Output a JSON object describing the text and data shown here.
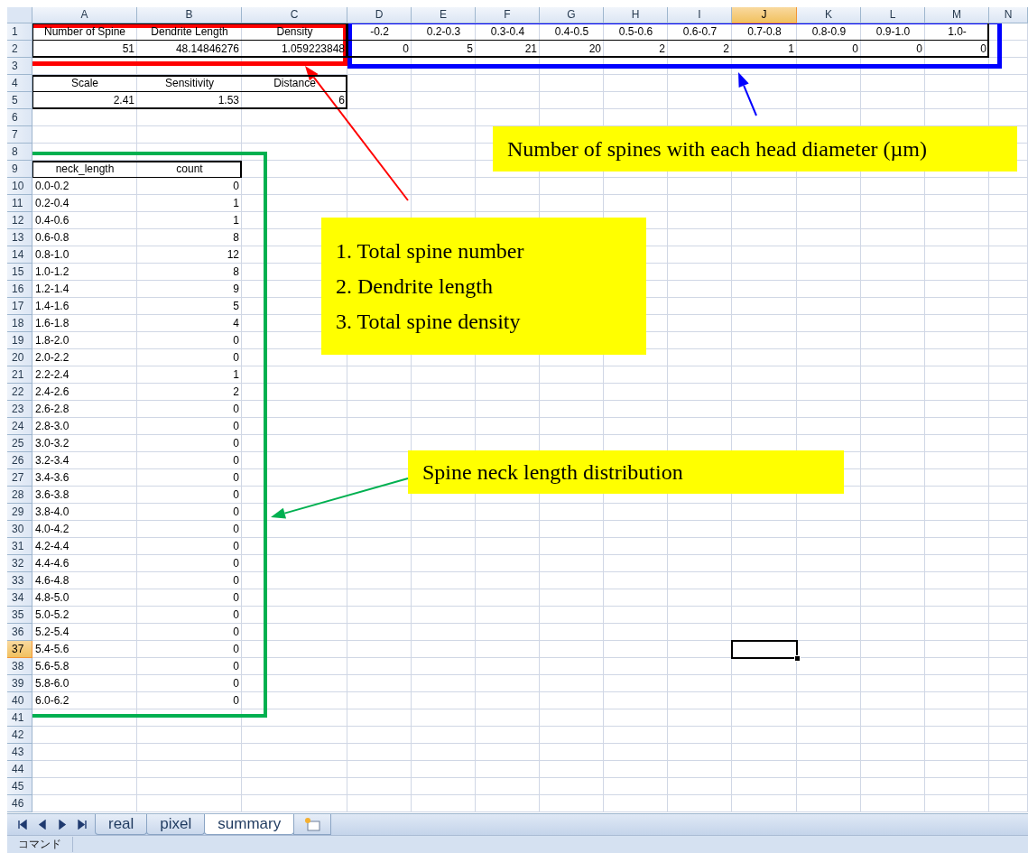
{
  "column_headers": [
    {
      "label": "A",
      "selected": false
    },
    {
      "label": "B",
      "selected": false
    },
    {
      "label": "C",
      "selected": false
    },
    {
      "label": "D",
      "selected": false
    },
    {
      "label": "E",
      "selected": false
    },
    {
      "label": "F",
      "selected": false
    },
    {
      "label": "G",
      "selected": false
    },
    {
      "label": "H",
      "selected": false
    },
    {
      "label": "I",
      "selected": false
    },
    {
      "label": "J",
      "selected": true
    },
    {
      "label": "K",
      "selected": false
    },
    {
      "label": "L",
      "selected": false
    },
    {
      "label": "M",
      "selected": false
    },
    {
      "label": "N",
      "selected": false
    }
  ],
  "row_headers": [
    {
      "label": "1",
      "selected": false
    },
    {
      "label": "2",
      "selected": false
    },
    {
      "label": "3",
      "selected": false
    },
    {
      "label": "4",
      "selected": false
    },
    {
      "label": "5",
      "selected": false
    },
    {
      "label": "6",
      "selected": false
    },
    {
      "label": "7",
      "selected": false
    },
    {
      "label": "8",
      "selected": false
    },
    {
      "label": "9",
      "selected": false
    },
    {
      "label": "10",
      "selected": false
    },
    {
      "label": "11",
      "selected": false
    },
    {
      "label": "12",
      "selected": false
    },
    {
      "label": "13",
      "selected": false
    },
    {
      "label": "14",
      "selected": false
    },
    {
      "label": "15",
      "selected": false
    },
    {
      "label": "16",
      "selected": false
    },
    {
      "label": "17",
      "selected": false
    },
    {
      "label": "18",
      "selected": false
    },
    {
      "label": "19",
      "selected": false
    },
    {
      "label": "20",
      "selected": false
    },
    {
      "label": "21",
      "selected": false
    },
    {
      "label": "22",
      "selected": false
    },
    {
      "label": "23",
      "selected": false
    },
    {
      "label": "24",
      "selected": false
    },
    {
      "label": "25",
      "selected": false
    },
    {
      "label": "26",
      "selected": false
    },
    {
      "label": "27",
      "selected": false
    },
    {
      "label": "28",
      "selected": false
    },
    {
      "label": "29",
      "selected": false
    },
    {
      "label": "30",
      "selected": false
    },
    {
      "label": "31",
      "selected": false
    },
    {
      "label": "32",
      "selected": false
    },
    {
      "label": "33",
      "selected": false
    },
    {
      "label": "34",
      "selected": false
    },
    {
      "label": "35",
      "selected": false
    },
    {
      "label": "36",
      "selected": false
    },
    {
      "label": "37",
      "selected": true
    },
    {
      "label": "38",
      "selected": false
    },
    {
      "label": "39",
      "selected": false
    },
    {
      "label": "40",
      "selected": false
    },
    {
      "label": "41",
      "selected": false
    },
    {
      "label": "42",
      "selected": false
    },
    {
      "label": "43",
      "selected": false
    },
    {
      "label": "44",
      "selected": false
    },
    {
      "label": "45",
      "selected": false
    },
    {
      "label": "46",
      "selected": false
    }
  ],
  "summary_table": {
    "headers": [
      "Number of Spine",
      "Dendrite Length",
      "Density"
    ],
    "values": [
      "51",
      "48.14846276",
      "1.059223848"
    ]
  },
  "head_diameter_table": {
    "headers": [
      "-0.2",
      "0.2-0.3",
      "0.3-0.4",
      "0.4-0.5",
      "0.5-0.6",
      "0.6-0.7",
      "0.7-0.8",
      "0.8-0.9",
      "0.9-1.0",
      "1.0-"
    ],
    "values": [
      "0",
      "5",
      "21",
      "20",
      "2",
      "2",
      "1",
      "0",
      "0",
      "0"
    ]
  },
  "parameters_table": {
    "headers": [
      "Scale",
      "Sensitivity",
      "Distance"
    ],
    "values": [
      "2.41",
      "1.53",
      "6"
    ]
  },
  "neck_length_table": {
    "headers": [
      "neck_length",
      "count"
    ],
    "rows": [
      {
        "neck_length": "0.0-0.2",
        "count": "0"
      },
      {
        "neck_length": "0.2-0.4",
        "count": "1"
      },
      {
        "neck_length": "0.4-0.6",
        "count": "1"
      },
      {
        "neck_length": "0.6-0.8",
        "count": "8"
      },
      {
        "neck_length": "0.8-1.0",
        "count": "12"
      },
      {
        "neck_length": "1.0-1.2",
        "count": "8"
      },
      {
        "neck_length": "1.2-1.4",
        "count": "9"
      },
      {
        "neck_length": "1.4-1.6",
        "count": "5"
      },
      {
        "neck_length": "1.6-1.8",
        "count": "4"
      },
      {
        "neck_length": "1.8-2.0",
        "count": "0"
      },
      {
        "neck_length": "2.0-2.2",
        "count": "0"
      },
      {
        "neck_length": "2.2-2.4",
        "count": "1"
      },
      {
        "neck_length": "2.4-2.6",
        "count": "2"
      },
      {
        "neck_length": "2.6-2.8",
        "count": "0"
      },
      {
        "neck_length": "2.8-3.0",
        "count": "0"
      },
      {
        "neck_length": "3.0-3.2",
        "count": "0"
      },
      {
        "neck_length": "3.2-3.4",
        "count": "0"
      },
      {
        "neck_length": "3.4-3.6",
        "count": "0"
      },
      {
        "neck_length": "3.6-3.8",
        "count": "0"
      },
      {
        "neck_length": "3.8-4.0",
        "count": "0"
      },
      {
        "neck_length": "4.0-4.2",
        "count": "0"
      },
      {
        "neck_length": "4.2-4.4",
        "count": "0"
      },
      {
        "neck_length": "4.4-4.6",
        "count": "0"
      },
      {
        "neck_length": "4.6-4.8",
        "count": "0"
      },
      {
        "neck_length": "4.8-5.0",
        "count": "0"
      },
      {
        "neck_length": "5.0-5.2",
        "count": "0"
      },
      {
        "neck_length": "5.2-5.4",
        "count": "0"
      },
      {
        "neck_length": "5.4-5.6",
        "count": "0"
      },
      {
        "neck_length": "5.6-5.8",
        "count": "0"
      },
      {
        "neck_length": "5.8-6.0",
        "count": "0"
      },
      {
        "neck_length": "6.0-6.2",
        "count": "0"
      }
    ]
  },
  "annotations": [
    {
      "color": "#0000ff",
      "lines": [
        "Number of spines with each head diameter (µm)"
      ]
    },
    {
      "color": "#ff0000",
      "lines": [
        "1. Total spine number",
        "2. Dendrite length",
        "3. Total spine density"
      ]
    },
    {
      "color": "#00b050",
      "lines": [
        "Spine neck length distribution"
      ]
    }
  ],
  "sheet_tabs": [
    {
      "label": "real",
      "selected": false
    },
    {
      "label": "pixel",
      "selected": false
    },
    {
      "label": "summary",
      "selected": true
    }
  ],
  "status_bar": {
    "text": "コマンド"
  }
}
